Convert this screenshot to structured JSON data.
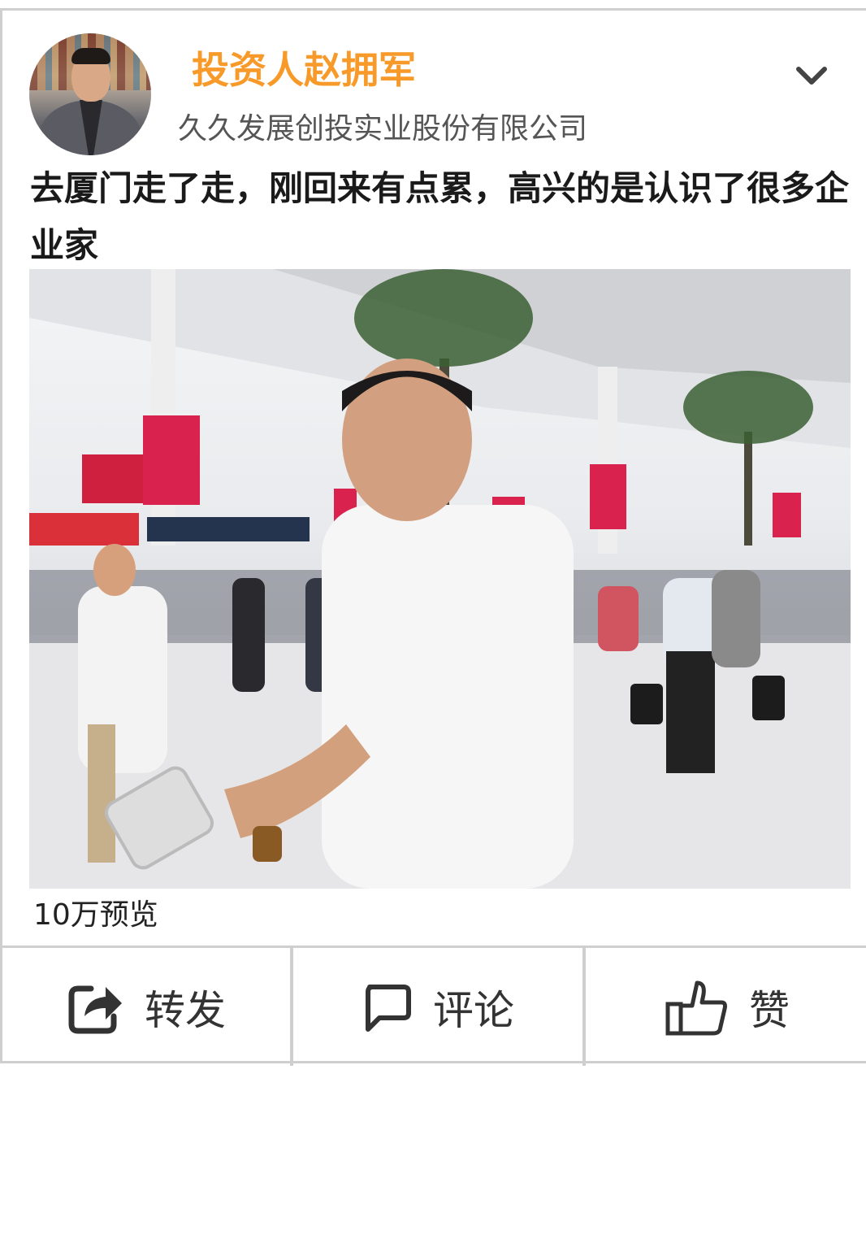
{
  "post": {
    "author": {
      "name": "投资人赵拥军",
      "company": "久久发展创投实业股份有限公司",
      "avatar_icon": "person-avatar",
      "name_color": "#f79a2a"
    },
    "menu_icon": "chevron-down-icon",
    "text": "去厦门走了走，刚回来有点累，高兴的是认识了很多企业家",
    "photo_description_icon": "photo",
    "views": "10万预览"
  },
  "actions": [
    {
      "label": "转发",
      "icon": "share-icon"
    },
    {
      "label": "评论",
      "icon": "comment-icon"
    },
    {
      "label": "赞",
      "icon": "thumbs-up-icon"
    }
  ]
}
